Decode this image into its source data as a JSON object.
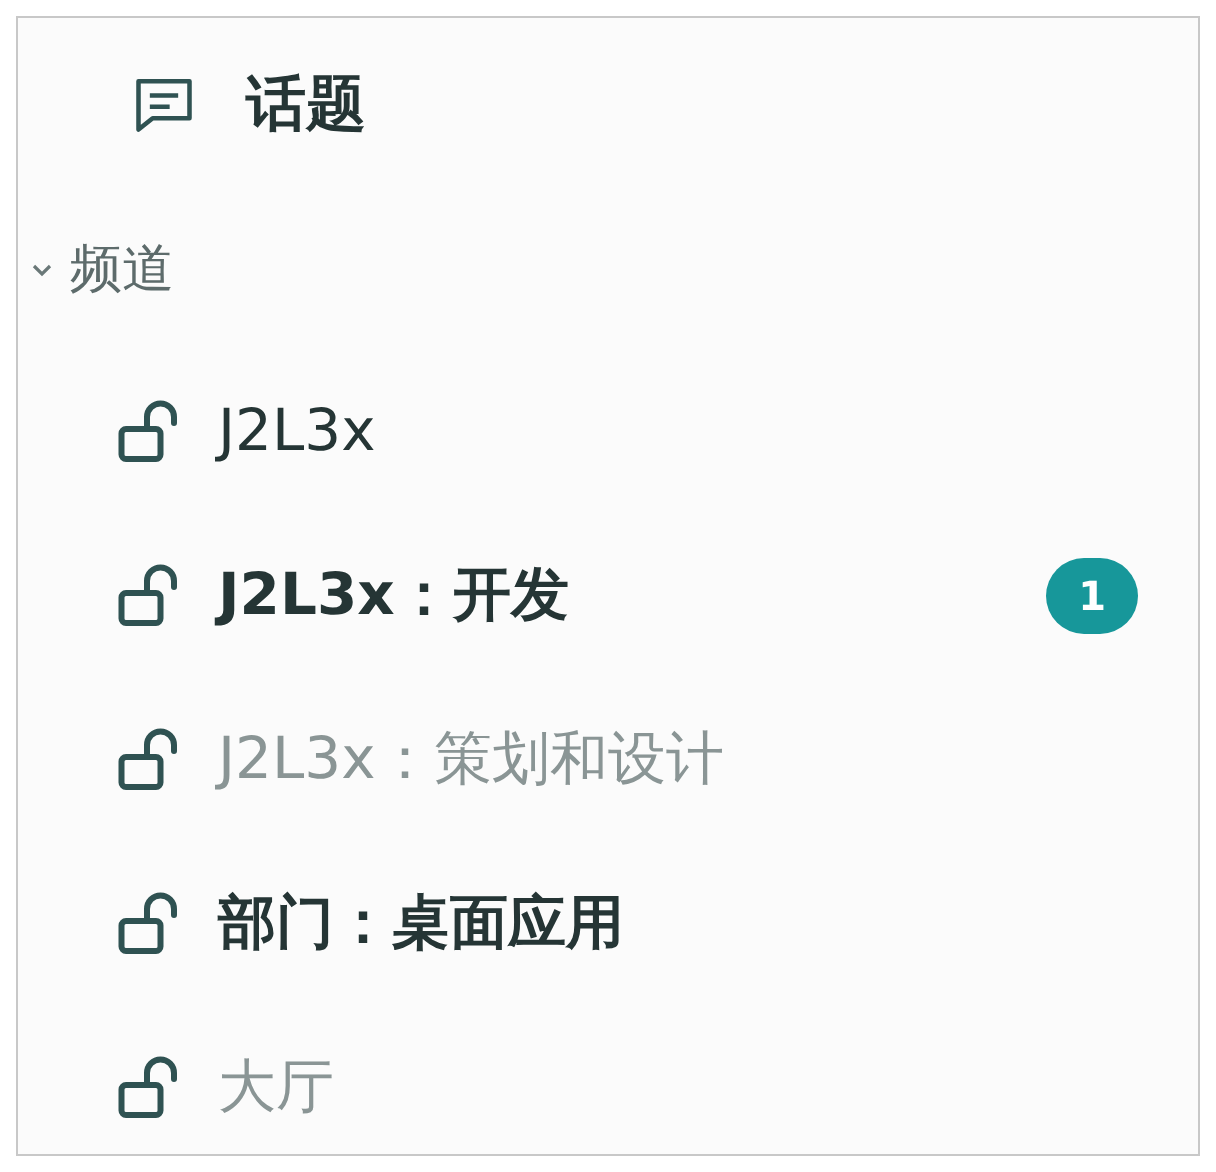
{
  "topics": {
    "label": "话题"
  },
  "section": {
    "label": "频道",
    "expanded": true
  },
  "channels": [
    {
      "name": "J2L3x",
      "unread": false,
      "dimmed": false
    },
    {
      "name": "J2L3x：开发",
      "unread": true,
      "dimmed": false,
      "badge": "1"
    },
    {
      "name": "J2L3x：策划和设计",
      "unread": false,
      "dimmed": true
    },
    {
      "name": "部门：桌面应用",
      "unread": true,
      "dimmed": false
    },
    {
      "name": "大厅",
      "unread": false,
      "dimmed": true
    }
  ]
}
